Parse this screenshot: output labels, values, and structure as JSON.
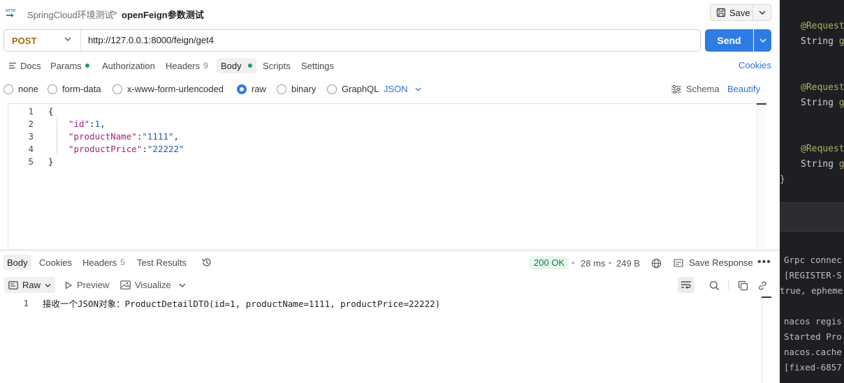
{
  "header": {
    "breadcrumb_parent": "SpringCloud环境测试",
    "breadcrumb_sep": ">",
    "breadcrumb_current": "openFeign参数测试",
    "save_label": "Save"
  },
  "request": {
    "method": "POST",
    "url": "http://127.0.0.1:8000/feign/get4",
    "send_label": "Send"
  },
  "request_tabs": {
    "docs": "Docs",
    "params": "Params",
    "authorization": "Authorization",
    "headers": "Headers",
    "headers_count": "9",
    "body": "Body",
    "scripts": "Scripts",
    "settings": "Settings",
    "cookies": "Cookies"
  },
  "body_types": {
    "none": "none",
    "form_data": "form-data",
    "urlencoded": "x-www-form-urlencoded",
    "raw": "raw",
    "binary": "binary",
    "graphql": "GraphQL",
    "language": "JSON",
    "schema": "Schema",
    "beautify": "Beautify",
    "selected": "raw"
  },
  "editor": {
    "lines": [
      {
        "num": "1",
        "text": "{"
      },
      {
        "num": "2",
        "key": "\"id\"",
        "sep": ":",
        "val": "1",
        "tail": ","
      },
      {
        "num": "3",
        "key": "\"productName\"",
        "sep": ":",
        "val": "\"1111\"",
        "tail": ","
      },
      {
        "num": "4",
        "key": "\"productPrice\"",
        "sep": ":",
        "val": "\"22222\"",
        "tail": ""
      },
      {
        "num": "5",
        "text": "}"
      }
    ]
  },
  "response_tabs": {
    "body": "Body",
    "cookies": "Cookies",
    "headers": "Headers",
    "headers_count": "5",
    "test_results": "Test Results",
    "status": "200 OK",
    "time": "28 ms",
    "size": "249 B",
    "save_response": "Save Response"
  },
  "response_toolbar": {
    "raw": "Raw",
    "preview": "Preview",
    "visualize": "Visualize"
  },
  "response_body": {
    "line_num": "1",
    "text": "接收一个JSON对象：ProductDetailDTO(id=1, productName=1111, productPrice=22222)"
  },
  "ide": {
    "code": [
      {
        "anno": "@Request",
        "kw": "String ",
        "tail": "g"
      },
      {
        "anno": "@Request",
        "kw": "String ",
        "tail": "g"
      },
      {
        "anno": "@Request",
        "kw": "String ",
        "tail": "g"
      }
    ],
    "close_brace": "}",
    "console": [
      "Grpc connec",
      "[REGISTER-S",
      "true, epheme",
      "",
      "nacos regis",
      "Started Pro",
      "nacos.cache",
      "[fixed-6857"
    ]
  },
  "colors": {
    "accent": "#2f7be5",
    "method": "#a66c00",
    "status_ok": "#137a3f",
    "link": "#2f6fd6",
    "ide_bg": "#1e1f22"
  }
}
